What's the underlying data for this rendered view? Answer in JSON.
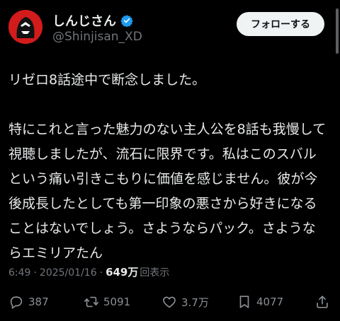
{
  "author": {
    "name": "しんじさん",
    "handle": "@Shinjisan_XD"
  },
  "follow_button": "フォローする",
  "tweet": {
    "text": "リゼロ8話途中で断念しました。\n\n特にこれと言った魅力のない主人公を8話も我慢して\n視聴しましたが、流石に限界です。私はこのスバル\nという痛い引きこもりに価値を感じません。彼が今\n後成長したとしても第一印象の悪さから好きになる\nことはないでしょう。さようならパック。さような\nらエミリアたん"
  },
  "meta": {
    "time": "6:49",
    "sep": "·",
    "date": "2025/01/16",
    "sep2": "·",
    "views": "649万",
    "views_label": "回表示"
  },
  "actions": {
    "replies": "387",
    "reposts": "5091",
    "likes": "3.7万",
    "bookmarks": "4077"
  },
  "colors": {
    "background": "#000000",
    "text": "#e7e9ea",
    "muted": "#71767b",
    "verified": "#1d9bf0",
    "avatar": "#d21b1b"
  },
  "icons": [
    "reply-icon",
    "repost-icon",
    "like-icon",
    "bookmark-icon",
    "share-icon",
    "verified-badge-icon"
  ]
}
